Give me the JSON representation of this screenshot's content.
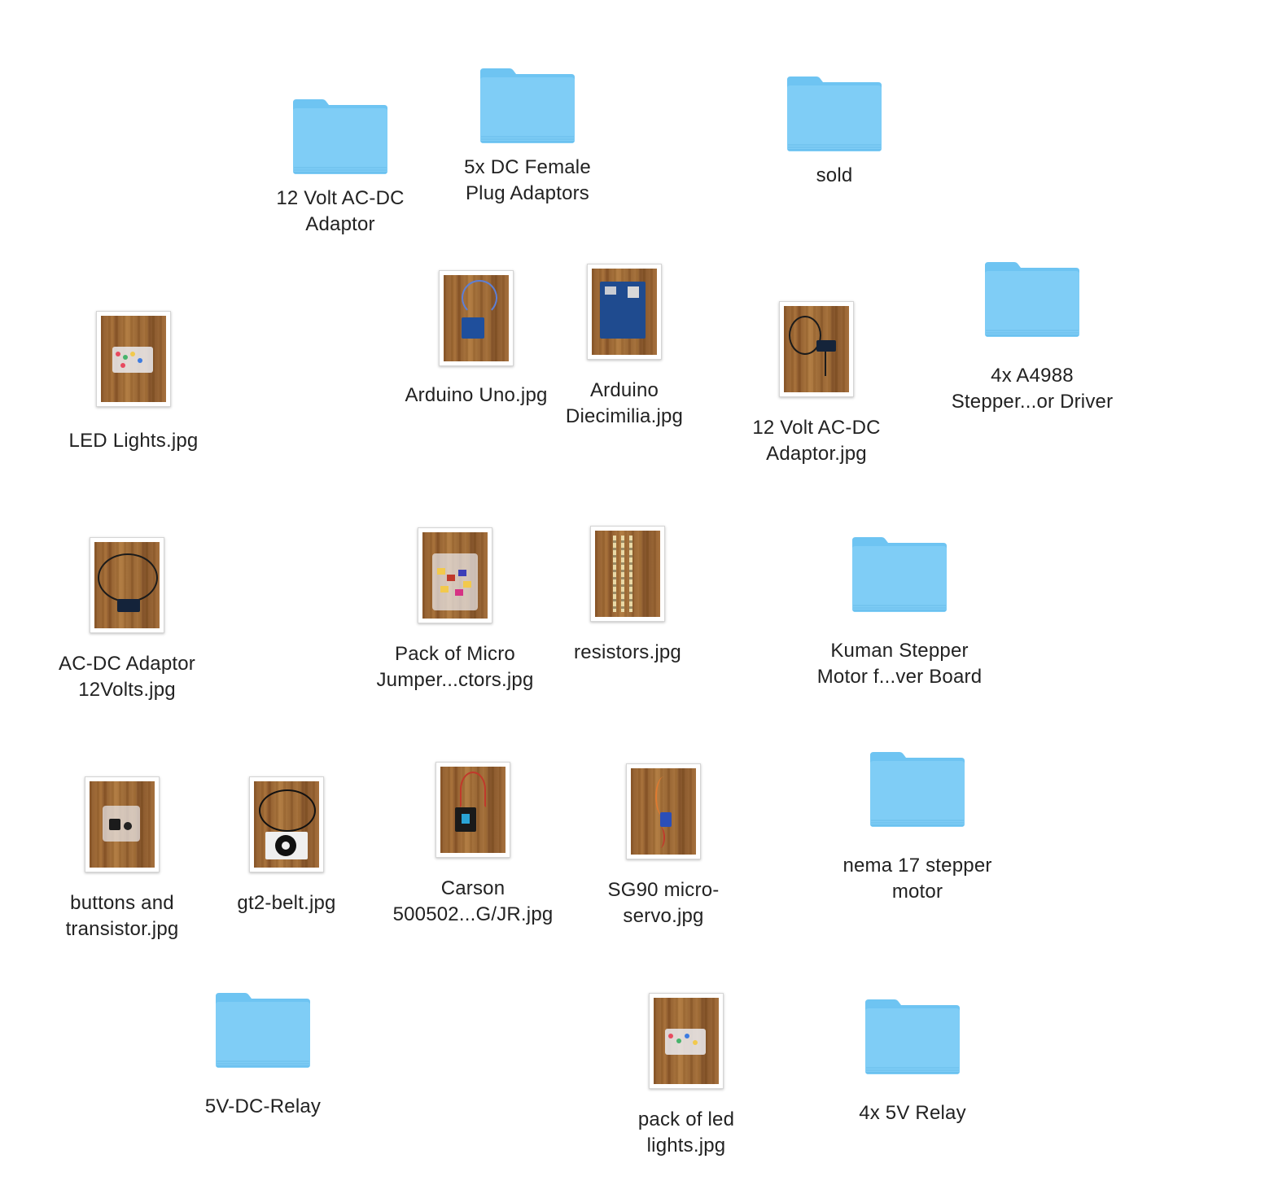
{
  "desktop": {
    "items": [
      {
        "label": "12 Volt AC-DC\nAdaptor",
        "kind": "folder",
        "icon": "folder-icon"
      },
      {
        "label": "5x DC Female\nPlug Adaptors",
        "kind": "folder",
        "icon": "folder-icon"
      },
      {
        "label": "sold",
        "kind": "folder",
        "icon": "folder-icon"
      },
      {
        "label": "LED Lights.jpg",
        "kind": "image",
        "icon": "image-thumbnail"
      },
      {
        "label": "Arduino Uno.jpg",
        "kind": "image",
        "icon": "image-thumbnail"
      },
      {
        "label": "Arduino\nDiecimilia.jpg",
        "kind": "image",
        "icon": "image-thumbnail"
      },
      {
        "label": "12 Volt AC-DC\nAdaptor.jpg",
        "kind": "image",
        "icon": "image-thumbnail"
      },
      {
        "label": "4x A4988\nStepper...or Driver",
        "kind": "folder",
        "icon": "folder-icon"
      },
      {
        "label": "AC-DC Adaptor\n12Volts.jpg",
        "kind": "image",
        "icon": "image-thumbnail"
      },
      {
        "label": "Pack of Micro\nJumper...ctors.jpg",
        "kind": "image",
        "icon": "image-thumbnail"
      },
      {
        "label": "resistors.jpg",
        "kind": "image",
        "icon": "image-thumbnail"
      },
      {
        "label": "Kuman Stepper\nMotor f...ver Board",
        "kind": "folder",
        "icon": "folder-icon"
      },
      {
        "label": "buttons and\ntransistor.jpg",
        "kind": "image",
        "icon": "image-thumbnail"
      },
      {
        "label": "gt2-belt.jpg",
        "kind": "image",
        "icon": "image-thumbnail"
      },
      {
        "label": "Carson\n500502...G/JR.jpg",
        "kind": "image",
        "icon": "image-thumbnail"
      },
      {
        "label": "SG90 micro-\nservo.jpg",
        "kind": "image",
        "icon": "image-thumbnail"
      },
      {
        "label": "nema 17 stepper\nmotor",
        "kind": "folder",
        "icon": "folder-icon"
      },
      {
        "label": "5V-DC-Relay",
        "kind": "folder",
        "icon": "folder-icon"
      },
      {
        "label": "pack of led\nlights.jpg",
        "kind": "image",
        "icon": "image-thumbnail"
      },
      {
        "label": "4x 5V Relay",
        "kind": "folder",
        "icon": "folder-icon"
      }
    ],
    "colors": {
      "folder_body": "#7fcdf6",
      "folder_top": "#6ec4f2",
      "folder_edge": "#58b5e8",
      "label_text": "#222222",
      "background": "#ffffff"
    }
  }
}
